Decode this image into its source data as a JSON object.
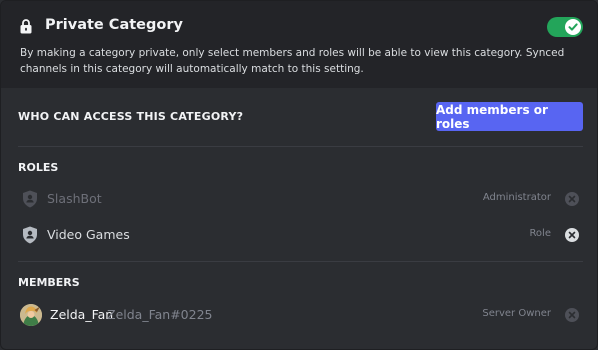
{
  "header": {
    "title": "Private Category",
    "toggle_on": true,
    "description": "By making a category private, only select members and roles will be able to view this category. Synced channels in this category will automatically match to this setting."
  },
  "access": {
    "heading": "WHO CAN ACCESS THIS CATEGORY?",
    "add_button_label": "Add members or roles"
  },
  "roles": {
    "label": "ROLES",
    "items": [
      {
        "name": "SlashBot",
        "tag": "Administrator",
        "disabled": true
      },
      {
        "name": "Video Games",
        "tag": "Role",
        "disabled": false
      }
    ]
  },
  "members": {
    "label": "MEMBERS",
    "items": [
      {
        "display_name": "Zelda_Fan",
        "username": "Zelda_Fan#0225",
        "tag": "Server Owner",
        "disabled": true
      }
    ]
  },
  "colors": {
    "accent": "#5865f2",
    "toggle_on": "#23a55a",
    "background": "#2b2d31",
    "header_background": "#232428"
  }
}
